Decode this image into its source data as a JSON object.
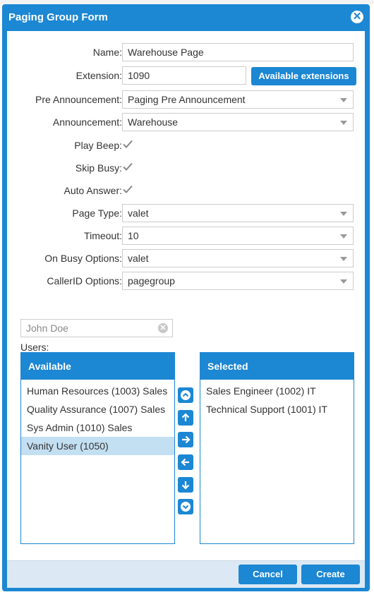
{
  "dialog": {
    "title": "Paging Group Form",
    "close_icon": "close-circle-icon"
  },
  "form": {
    "name": {
      "label": "Name:",
      "value": "Warehouse Page"
    },
    "extension": {
      "label": "Extension:",
      "value": "1090",
      "button": "Available extensions"
    },
    "pre_announcement": {
      "label": "Pre Announcement:",
      "value": "Paging Pre Announcement"
    },
    "announcement": {
      "label": "Announcement:",
      "value": "Warehouse"
    },
    "play_beep": {
      "label": "Play Beep:",
      "checked": true
    },
    "skip_busy": {
      "label": "Skip Busy:",
      "checked": true
    },
    "auto_answer": {
      "label": "Auto Answer:",
      "checked": true
    },
    "page_type": {
      "label": "Page Type:",
      "value": "valet"
    },
    "timeout": {
      "label": "Timeout:",
      "value": "10"
    },
    "on_busy": {
      "label": "On Busy Options:",
      "value": "valet"
    },
    "caller_id": {
      "label": "CallerID Options:",
      "value": "pagegroup"
    }
  },
  "users": {
    "search_placeholder": "John Doe",
    "label": "Users:",
    "available": {
      "header": "Available",
      "items": [
        "Human Resources (1003) Sales",
        "Quality Assurance (1007) Sales",
        "Sys Admin (1010) Sales",
        "Vanity User (1050)"
      ],
      "selected_index": 3
    },
    "selected": {
      "header": "Selected",
      "items": [
        "Sales Engineer (1002) IT",
        "Technical Support (1001) IT"
      ]
    },
    "transfer_icons": [
      "move-top-icon",
      "move-up-icon",
      "move-right-icon",
      "move-left-icon",
      "move-down-icon",
      "move-bottom-icon"
    ]
  },
  "footer": {
    "cancel": "Cancel",
    "create": "Create"
  },
  "colors": {
    "accent": "#1c87d3",
    "selected_row": "#c3dff2",
    "footer_bg": "#dce9f5"
  }
}
